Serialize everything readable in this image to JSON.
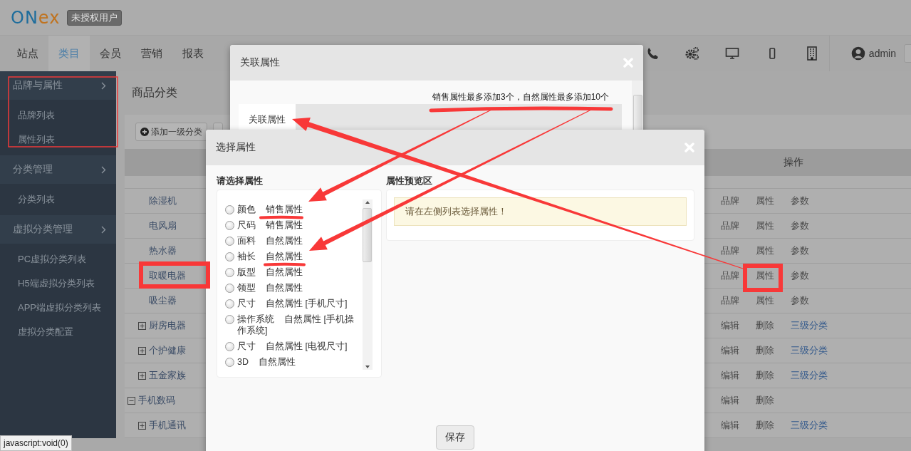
{
  "header": {
    "logo": "ONex",
    "badge": "未授权用户"
  },
  "nav": {
    "items": [
      {
        "label": "站点",
        "selected": false
      },
      {
        "label": "类目",
        "selected": true
      },
      {
        "label": "会员",
        "selected": false
      },
      {
        "label": "营销",
        "selected": false
      },
      {
        "label": "报表",
        "selected": false
      }
    ],
    "user": "admin"
  },
  "sidebar": {
    "groups": [
      {
        "title": "品牌与属性",
        "items": [
          "品牌列表",
          "属性列表"
        ]
      },
      {
        "title": "分类管理",
        "items": [
          "分类列表"
        ]
      },
      {
        "title": "虚拟分类管理",
        "items": [
          "PC虚拟分类列表",
          "H5端虚拟分类列表",
          "APP端虚拟分类列表",
          "虚拟分类配置"
        ]
      }
    ]
  },
  "main": {
    "title": "商品分类",
    "add_button": "添加一级分类",
    "table": {
      "columns": [
        "操作"
      ],
      "rows": [
        {
          "children": [
            {
              "children": [
                {
                  "name": "除湿机",
                  "actions": [
                    {
                      "label": "品牌",
                      "kind": "muted"
                    },
                    {
                      "label": "属性",
                      "kind": "muted"
                    },
                    {
                      "label": "参数",
                      "kind": "muted"
                    }
                  ]
                },
                {
                  "name": "电风扇",
                  "actions": [
                    {
                      "label": "品牌",
                      "kind": "muted"
                    },
                    {
                      "label": "属性",
                      "kind": "muted"
                    },
                    {
                      "label": "参数",
                      "kind": "muted"
                    }
                  ]
                },
                {
                  "name": "热水器",
                  "actions": [
                    {
                      "label": "品牌",
                      "kind": "muted"
                    },
                    {
                      "label": "属性",
                      "kind": "muted"
                    },
                    {
                      "label": "参数",
                      "kind": "muted"
                    }
                  ]
                },
                {
                  "name": "取暖电器",
                  "actions": [
                    {
                      "label": "品牌",
                      "kind": "muted"
                    },
                    {
                      "label": "属性",
                      "kind": "muted"
                    },
                    {
                      "label": "参数",
                      "kind": "muted"
                    }
                  ]
                },
                {
                  "name": "吸尘器",
                  "actions": [
                    {
                      "label": "品牌",
                      "kind": "muted"
                    },
                    {
                      "label": "属性",
                      "kind": "muted"
                    },
                    {
                      "label": "参数",
                      "kind": "muted"
                    }
                  ]
                }
              ]
            },
            {
              "name": "厨房电器",
              "expanded": false,
              "actions": [
                {
                  "label": "编辑",
                  "kind": "muted"
                },
                {
                  "label": "删除",
                  "kind": "muted"
                },
                {
                  "label": "三级分类",
                  "kind": "link"
                }
              ]
            },
            {
              "name": "个护健康",
              "expanded": false,
              "actions": [
                {
                  "label": "编辑",
                  "kind": "muted"
                },
                {
                  "label": "删除",
                  "kind": "muted"
                },
                {
                  "label": "三级分类",
                  "kind": "link"
                }
              ]
            },
            {
              "name": "五金家族",
              "expanded": false,
              "actions": [
                {
                  "label": "编辑",
                  "kind": "muted"
                },
                {
                  "label": "删除",
                  "kind": "muted"
                },
                {
                  "label": "三级分类",
                  "kind": "link"
                }
              ]
            }
          ]
        },
        {
          "name": "手机数码",
          "expanded": true,
          "actions": [
            {
              "label": "编辑",
              "kind": "muted"
            },
            {
              "label": "删除",
              "kind": "muted"
            }
          ],
          "children": [
            {
              "name": "手机通讯",
              "expanded": false,
              "actions": [
                {
                  "label": "编辑",
                  "kind": "muted"
                },
                {
                  "label": "删除",
                  "kind": "muted"
                },
                {
                  "label": "三级分类",
                  "kind": "link"
                }
              ]
            }
          ]
        }
      ]
    }
  },
  "status_bar": "javascript:void(0)",
  "link_dialog": {
    "title": "关联属性",
    "notice": "销售属性最多添加3个，自然属性最多添加10个",
    "tabs": [
      {
        "label": "关联属性",
        "selected": true
      }
    ]
  },
  "select_dialog": {
    "title": "选择属性",
    "list_heading": "请选择属性",
    "attributes": [
      {
        "name": "颜色",
        "type": "销售属性",
        "selected": false
      },
      {
        "name": "尺码",
        "type": "销售属性",
        "selected": false
      },
      {
        "name": "面料",
        "type": "自然属性",
        "selected": false
      },
      {
        "name": "袖长",
        "type": "自然属性",
        "selected": false
      },
      {
        "name": "版型",
        "type": "自然属性",
        "selected": false
      },
      {
        "name": "领型",
        "type": "自然属性",
        "selected": false
      },
      {
        "name": "尺寸",
        "type": "自然属性",
        "note": "[手机尺寸]",
        "selected": false
      },
      {
        "name": "操作系统",
        "type": "自然属性",
        "note": "[手机操作系统]",
        "selected": false
      },
      {
        "name": "尺寸",
        "type": "自然属性",
        "note": "[电视尺寸]",
        "selected": false
      },
      {
        "name": "3D",
        "type": "自然属性",
        "selected": false
      }
    ],
    "preview_heading": "属性预览区",
    "preview_message": "请在左侧列表选择属性！",
    "save_button": "保存"
  }
}
